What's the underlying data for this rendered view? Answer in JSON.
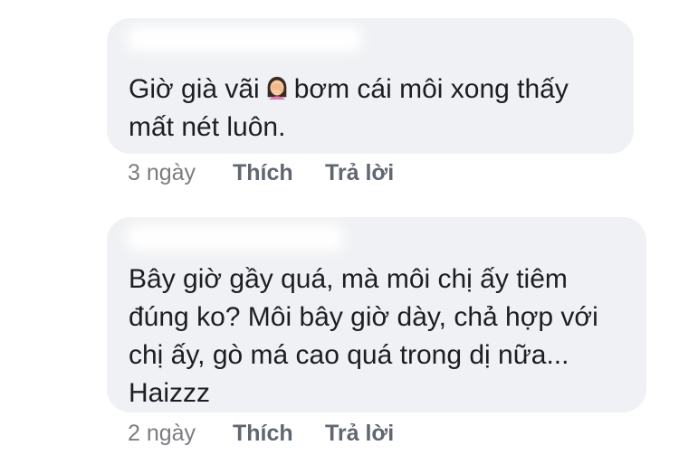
{
  "comments": [
    {
      "lines": [
        "Giờ già vãi",
        "bơm cái môi xong thấy",
        "mất nét luôn."
      ],
      "emoji": "woman-facepalming-icon",
      "time": "3 ngày",
      "like_label": "Thích",
      "reply_label": "Trả lời"
    },
    {
      "lines": [
        "Bây giờ gầy quá, mà môi chị ấy tiêm",
        "đúng ko? Môi bây giờ dày, chả hợp với",
        "chị ấy, gò má cao quá trong dị nữa...",
        "Haizzz"
      ],
      "time": "2 ngày",
      "like_label": "Thích",
      "reply_label": "Trả lời"
    }
  ],
  "colors": {
    "bubble": "#f0f1f4",
    "text": "#1c1e21",
    "meta": "#65676b"
  }
}
